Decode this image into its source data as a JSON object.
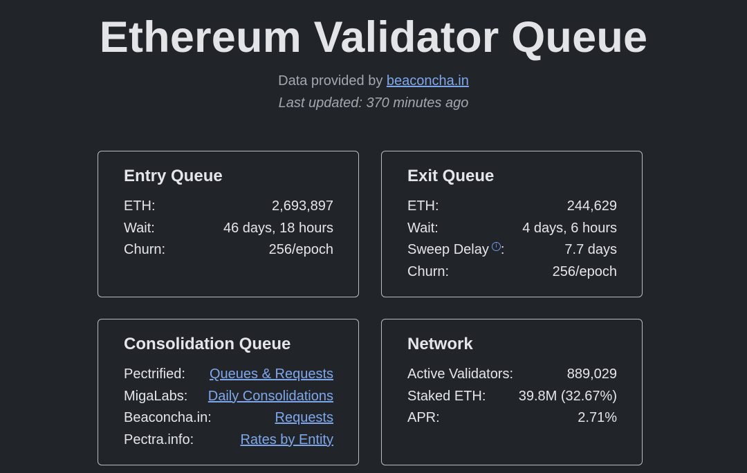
{
  "header": {
    "title": "Ethereum Validator Queue",
    "provided_prefix": "Data provided by ",
    "provider_link": "beaconcha.in",
    "last_updated": "Last updated: 370 minutes ago"
  },
  "entry_queue": {
    "title": "Entry Queue",
    "rows": [
      {
        "label": "ETH:",
        "value": "2,693,897"
      },
      {
        "label": "Wait:",
        "value": "46 days, 18 hours"
      },
      {
        "label": "Churn:",
        "value": "256/epoch"
      }
    ]
  },
  "exit_queue": {
    "title": "Exit Queue",
    "rows": [
      {
        "label": "ETH:",
        "value": "244,629"
      },
      {
        "label": "Wait:",
        "value": "4 days, 6 hours"
      },
      {
        "label": "Sweep Delay",
        "suffix": ":",
        "value": "7.7 days"
      },
      {
        "label": "Churn:",
        "value": "256/epoch"
      }
    ],
    "info_icon": "info-circle-icon",
    "info_glyph": "i"
  },
  "consolidation_queue": {
    "title": "Consolidation Queue",
    "rows": [
      {
        "label": "Pectrified:",
        "link": "Queues & Requests"
      },
      {
        "label": "MigaLabs:",
        "link": "Daily Consolidations"
      },
      {
        "label": "Beaconcha.in:",
        "link": "Requests"
      },
      {
        "label": "Pectra.info:",
        "link": "Rates by Entity"
      }
    ]
  },
  "network": {
    "title": "Network",
    "rows": [
      {
        "label": "Active Validators:",
        "value": "889,029"
      },
      {
        "label": "Staked ETH:",
        "value": "39.8M (32.67%)"
      },
      {
        "label": "APR:",
        "value": "2.71%"
      }
    ]
  },
  "colors": {
    "background": "#212429",
    "text": "#e4e6ea",
    "muted": "#a3a8b0",
    "link": "#7fa8ec",
    "card_border": "#b9bcc1"
  }
}
